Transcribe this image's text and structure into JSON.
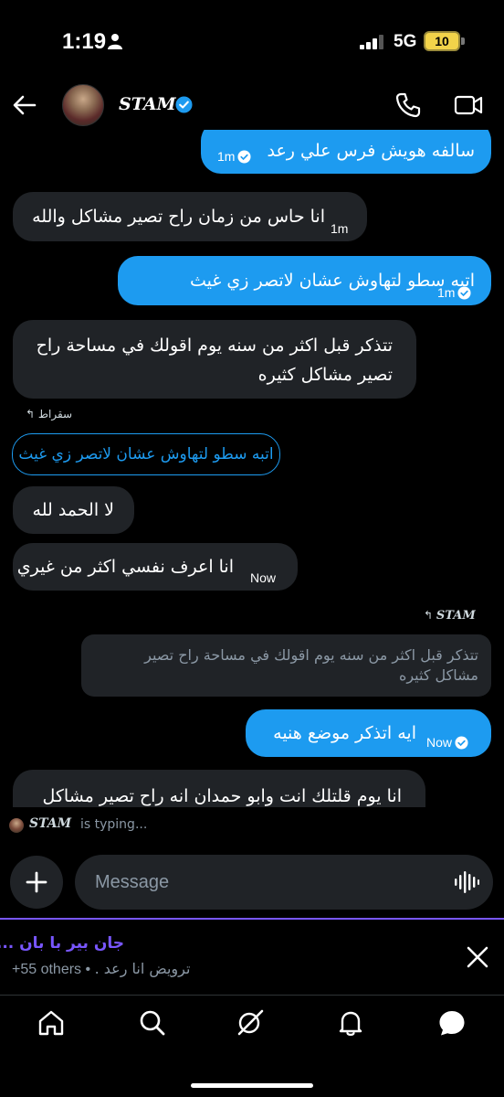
{
  "status_bar": {
    "time": "1:19",
    "network": "5G",
    "battery": "10"
  },
  "header": {
    "contact_name": "STAM",
    "verified": true
  },
  "messages": [
    {
      "dir": "sent",
      "text": "سالفه هويش فرس علي رعد",
      "time": "1m"
    },
    {
      "dir": "received",
      "text": "انا حاس من زمان راح تصير مشاكل والله",
      "time": "1m"
    },
    {
      "dir": "sent",
      "text": "اتبه سطو لتهاوش عشان لاتصر زي غيث",
      "time": "1m"
    },
    {
      "dir": "received",
      "text_line1": "تتذكر قبل اكثر من سنه يوم اقولك في مساحة راح",
      "text_line2": "تصير مشاكل كثيره"
    },
    {
      "dir": "received",
      "reply_to": "سقراط",
      "quoted": "اتبه سطو لتهاوش عشان لاتصر زي غيث"
    },
    {
      "dir": "received",
      "text": "لا الحمد لله"
    },
    {
      "dir": "received",
      "text": "انا اعرف نفسي اكثر من غيري",
      "time": "Now"
    },
    {
      "dir": "sent",
      "reply_to": "STAM",
      "quoted_line1": "تتذكر قبل اكثر من سنه يوم اقولك في مساحة راح تصير",
      "quoted_line2": "مشاكل كثيره"
    },
    {
      "dir": "sent",
      "text": "ايه اتذكر موضع هنيه",
      "time": "Now"
    },
    {
      "dir": "received",
      "text": "انا يوم قلتلك انت وابو حمدان انه راح تصير مشاكل"
    }
  ],
  "typing": {
    "name": "STAM",
    "text": "is typing..."
  },
  "composer": {
    "placeholder": "Message"
  },
  "space": {
    "title": "جان بير با بان ...",
    "others": "+55 others",
    "separator": "•",
    "topic": "ترويض انا رعد ."
  },
  "colors": {
    "accent": "#1d9bf0",
    "space_accent": "#7856ff",
    "bubble_received": "#202327"
  },
  "nav": [
    "home-icon",
    "search-icon",
    "grok-icon",
    "notifications-icon",
    "messages-icon"
  ]
}
